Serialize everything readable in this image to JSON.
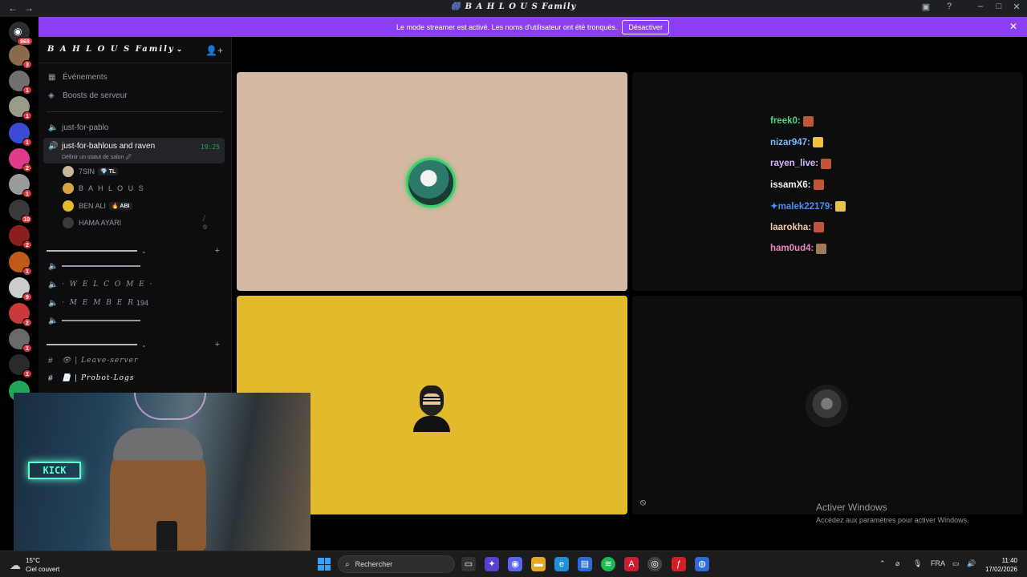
{
  "window": {
    "title": "🎆 B A H L O U S Family",
    "nav_back": "←",
    "nav_forward": "→"
  },
  "banner": {
    "text": "Le mode streamer est activé. Les noms d'utilisateur ont été tronqués.",
    "button": "Désactiver"
  },
  "rail": {
    "home_badge": "868",
    "servers": [
      {
        "badge": "3",
        "color": "#8a6a4a"
      },
      {
        "badge": "1",
        "color": "#6f6f6f"
      },
      {
        "badge": "1",
        "color": "#9b9b8b"
      },
      {
        "badge": "1",
        "color": "#3b4bd6"
      },
      {
        "badge": "2",
        "color": "#e03a8a"
      },
      {
        "badge": "1",
        "color": "#9a9a9a"
      },
      {
        "badge": "10",
        "color": "#3a3a3a"
      },
      {
        "badge": "2",
        "color": "#8a1f1f"
      },
      {
        "badge": "1",
        "color": "#c05a1a"
      },
      {
        "badge": "9",
        "color": "#cccccc"
      },
      {
        "badge": "2",
        "color": "#c83a3a"
      },
      {
        "badge": "1",
        "color": "#6a6a6a"
      },
      {
        "badge": "1",
        "color": "#2a2a2a"
      },
      {
        "badge": "",
        "color": "#23a55a"
      }
    ]
  },
  "sidebar": {
    "server_name": "B A H L O U S Family",
    "menu": [
      {
        "label": "Événements"
      },
      {
        "label": "Boosts de serveur"
      }
    ],
    "channels_top": [
      {
        "label": "just-for-pablo"
      }
    ],
    "active_channel": {
      "label": "just-for-bahlous and raven",
      "status": "Définir un statut de salon 🖉",
      "time": "19:25"
    },
    "voice_users": [
      {
        "name": "7SIN",
        "tag": "💎 TL",
        "color": "#c9b79c"
      },
      {
        "name": "B A H L O U S",
        "tag": "",
        "color": "#d9a441"
      },
      {
        "name": "BEN ALI",
        "tag": "🔥 ABI",
        "color": "#e2bb2c"
      },
      {
        "name": "HAMA AYARI",
        "tag": "",
        "color": "#3a3a3a"
      }
    ],
    "voice_channels": [
      {
        "label": "",
        "type": "line"
      },
      {
        "label": "· W E L C O M E ·",
        "type": "deco"
      },
      {
        "label": "· M E M B E R",
        "type": "deco",
        "count": "194"
      },
      {
        "label": "",
        "type": "line"
      }
    ],
    "text_channels": [
      {
        "label": "👁 | Leave-server"
      },
      {
        "label": "📄 | Probot-Logs"
      }
    ]
  },
  "stage": {
    "chat_lines": [
      {
        "name": "freek0:",
        "color": "#4fd08a"
      },
      {
        "name": "nizar947:",
        "color": "#7cb7ff"
      },
      {
        "name": "rayen_live:",
        "color": "#d6b6ff"
      },
      {
        "name": "issamX6:",
        "color": "#f2f3f5"
      },
      {
        "name": "✦malek22179:",
        "color": "#4b8ef5"
      },
      {
        "name": "laarokha:",
        "color": "#f7c6a8"
      },
      {
        "name": "ham0ud4:",
        "color": "#e88ac0"
      }
    ],
    "watermark": {
      "title": "Activer Windows",
      "subtitle": "Accédez aux paramètres pour activer Windows."
    }
  },
  "taskbar": {
    "temperature": "15°C",
    "weather": "Ciel couvert",
    "search_placeholder": "Rechercher",
    "language": "FRA",
    "time": "11:40",
    "date": "17/02/2026"
  },
  "colors": {
    "banner": "#8c3ff0",
    "tile_pink": "#d4b8a2",
    "tile_yellow": "#e2bb2c",
    "voice_active": "#23a55a"
  }
}
